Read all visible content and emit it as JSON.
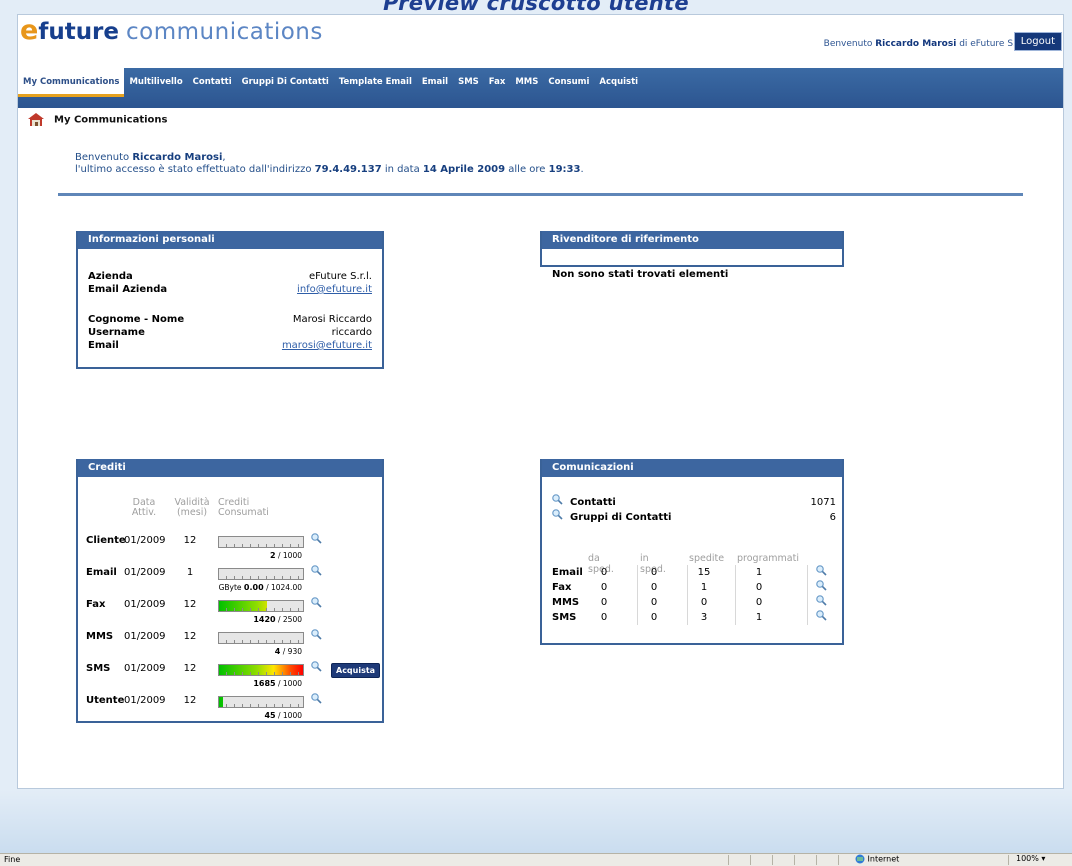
{
  "window_title": "Preview cruscotto utente",
  "header": {
    "logo_e": "e",
    "logo_future": "future",
    "logo_comm": "communications",
    "welcome_prefix": "Benvenuto",
    "user_name": "Riccardo Marosi",
    "welcome_of": "di eFuture S.r.l.",
    "logout_label": "Logout"
  },
  "nav": [
    "My Communications",
    "Multilivello",
    "Contatti",
    "Gruppi Di Contatti",
    "Template Email",
    "Email",
    "SMS",
    "Fax",
    "MMS",
    "Consumi",
    "Acquisti"
  ],
  "breadcrumb": "My Communications",
  "intro": {
    "line1_prefix": "Benvenuto",
    "name": "Riccardo Marosi",
    "line1_suffix": ",",
    "line2_a": "l'ultimo accesso è stato effettuato dall'indirizzo",
    "ip": "79.4.49.137",
    "line2_b": "in data",
    "date": "14 Aprile 2009",
    "line2_c": "alle ore",
    "time": "19:33",
    "line2_d": "."
  },
  "personal": {
    "title": "Informazioni personali",
    "azienda_label": "Azienda",
    "azienda": "eFuture S.r.l.",
    "email_az_label": "Email Azienda",
    "email_az": "info@efuture.it",
    "nome_label": "Cognome - Nome",
    "nome": "Marosi Riccardo",
    "user_label": "Username",
    "user": "riccardo",
    "email_label": "Email",
    "email": "marosi@efuture.it"
  },
  "reseller": {
    "title": "Rivenditore di riferimento",
    "empty": "Non sono stati trovati elementi"
  },
  "credits": {
    "title": "Crediti",
    "head_date": "Data Attiv.",
    "head_valid": "Validità (mesi)",
    "head_cons": "Crediti Consumati",
    "buy_label": "Acquista",
    "rows": [
      {
        "label": "Cliente",
        "date": "01/2009",
        "valid": "12",
        "used": "2",
        "total": "/ 1000",
        "prefix": "",
        "fraction": 0.002
      },
      {
        "label": "Email",
        "date": "01/2009",
        "valid": "1",
        "used": "0.00",
        "total": "/ 1024.00",
        "prefix": "GByte",
        "fraction": 0.0
      },
      {
        "label": "Fax",
        "date": "01/2009",
        "valid": "12",
        "used": "1420",
        "total": "/ 2500",
        "prefix": "",
        "fraction": 0.568
      },
      {
        "label": "MMS",
        "date": "01/2009",
        "valid": "12",
        "used": "4",
        "total": "/ 930",
        "prefix": "",
        "fraction": 0.004
      },
      {
        "label": "SMS",
        "date": "01/2009",
        "valid": "12",
        "used": "1685",
        "total": "/ 1000",
        "prefix": "",
        "fraction": 1.0
      },
      {
        "label": "Utente",
        "date": "01/2009",
        "valid": "12",
        "used": "45",
        "total": "/ 1000",
        "prefix": "",
        "fraction": 0.045
      }
    ]
  },
  "comm": {
    "title": "Comunicazioni",
    "contatti_label": "Contatti",
    "contatti": "1071",
    "gruppi_label": "Gruppi di Contatti",
    "gruppi": "6",
    "headers": [
      "da sped.",
      "in sped.",
      "spedite",
      "programmati"
    ],
    "rows": [
      {
        "label": "Email",
        "vals": [
          "0",
          "0",
          "15",
          "1"
        ]
      },
      {
        "label": "Fax",
        "vals": [
          "0",
          "0",
          "1",
          "0"
        ]
      },
      {
        "label": "MMS",
        "vals": [
          "0",
          "0",
          "0",
          "0"
        ]
      },
      {
        "label": "SMS",
        "vals": [
          "0",
          "0",
          "3",
          "1"
        ]
      }
    ]
  },
  "status": {
    "left": "Fine",
    "zone": "Internet",
    "zoom": "100%"
  }
}
